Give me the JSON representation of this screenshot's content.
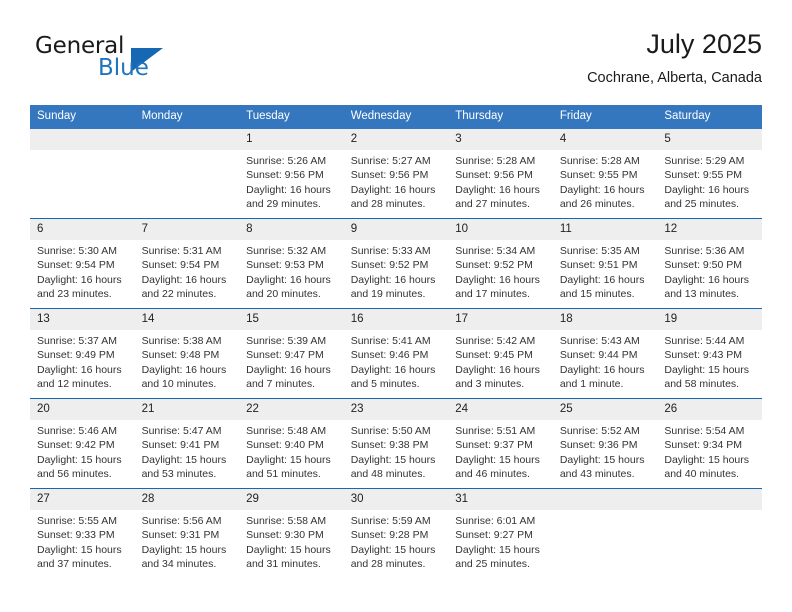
{
  "logo": {
    "word_one": "General",
    "word_two": "Blue",
    "accent_color": "#1668b3",
    "triangle_icon": "triangle-icon"
  },
  "header": {
    "title": "July 2025",
    "location": "Cochrane, Alberta, Canada"
  },
  "theme": {
    "header_bg": "#3577bf",
    "divider": "#1668b3",
    "daynum_bg": "#eeeeee",
    "text": "#222222"
  },
  "calendar": {
    "weekday_headers": [
      "Sunday",
      "Monday",
      "Tuesday",
      "Wednesday",
      "Thursday",
      "Friday",
      "Saturday"
    ],
    "weeks": [
      [
        {
          "day": "",
          "empty": true,
          "sunrise": "",
          "sunset": "",
          "daylight_line1": "",
          "daylight_line2": ""
        },
        {
          "day": "",
          "empty": true,
          "sunrise": "",
          "sunset": "",
          "daylight_line1": "",
          "daylight_line2": ""
        },
        {
          "day": "1",
          "sunrise": "Sunrise: 5:26 AM",
          "sunset": "Sunset: 9:56 PM",
          "daylight_line1": "Daylight: 16 hours",
          "daylight_line2": "and 29 minutes."
        },
        {
          "day": "2",
          "sunrise": "Sunrise: 5:27 AM",
          "sunset": "Sunset: 9:56 PM",
          "daylight_line1": "Daylight: 16 hours",
          "daylight_line2": "and 28 minutes."
        },
        {
          "day": "3",
          "sunrise": "Sunrise: 5:28 AM",
          "sunset": "Sunset: 9:56 PM",
          "daylight_line1": "Daylight: 16 hours",
          "daylight_line2": "and 27 minutes."
        },
        {
          "day": "4",
          "sunrise": "Sunrise: 5:28 AM",
          "sunset": "Sunset: 9:55 PM",
          "daylight_line1": "Daylight: 16 hours",
          "daylight_line2": "and 26 minutes."
        },
        {
          "day": "5",
          "sunrise": "Sunrise: 5:29 AM",
          "sunset": "Sunset: 9:55 PM",
          "daylight_line1": "Daylight: 16 hours",
          "daylight_line2": "and 25 minutes."
        }
      ],
      [
        {
          "day": "6",
          "sunrise": "Sunrise: 5:30 AM",
          "sunset": "Sunset: 9:54 PM",
          "daylight_line1": "Daylight: 16 hours",
          "daylight_line2": "and 23 minutes."
        },
        {
          "day": "7",
          "sunrise": "Sunrise: 5:31 AM",
          "sunset": "Sunset: 9:54 PM",
          "daylight_line1": "Daylight: 16 hours",
          "daylight_line2": "and 22 minutes."
        },
        {
          "day": "8",
          "sunrise": "Sunrise: 5:32 AM",
          "sunset": "Sunset: 9:53 PM",
          "daylight_line1": "Daylight: 16 hours",
          "daylight_line2": "and 20 minutes."
        },
        {
          "day": "9",
          "sunrise": "Sunrise: 5:33 AM",
          "sunset": "Sunset: 9:52 PM",
          "daylight_line1": "Daylight: 16 hours",
          "daylight_line2": "and 19 minutes."
        },
        {
          "day": "10",
          "sunrise": "Sunrise: 5:34 AM",
          "sunset": "Sunset: 9:52 PM",
          "daylight_line1": "Daylight: 16 hours",
          "daylight_line2": "and 17 minutes."
        },
        {
          "day": "11",
          "sunrise": "Sunrise: 5:35 AM",
          "sunset": "Sunset: 9:51 PM",
          "daylight_line1": "Daylight: 16 hours",
          "daylight_line2": "and 15 minutes."
        },
        {
          "day": "12",
          "sunrise": "Sunrise: 5:36 AM",
          "sunset": "Sunset: 9:50 PM",
          "daylight_line1": "Daylight: 16 hours",
          "daylight_line2": "and 13 minutes."
        }
      ],
      [
        {
          "day": "13",
          "sunrise": "Sunrise: 5:37 AM",
          "sunset": "Sunset: 9:49 PM",
          "daylight_line1": "Daylight: 16 hours",
          "daylight_line2": "and 12 minutes."
        },
        {
          "day": "14",
          "sunrise": "Sunrise: 5:38 AM",
          "sunset": "Sunset: 9:48 PM",
          "daylight_line1": "Daylight: 16 hours",
          "daylight_line2": "and 10 minutes."
        },
        {
          "day": "15",
          "sunrise": "Sunrise: 5:39 AM",
          "sunset": "Sunset: 9:47 PM",
          "daylight_line1": "Daylight: 16 hours",
          "daylight_line2": "and 7 minutes."
        },
        {
          "day": "16",
          "sunrise": "Sunrise: 5:41 AM",
          "sunset": "Sunset: 9:46 PM",
          "daylight_line1": "Daylight: 16 hours",
          "daylight_line2": "and 5 minutes."
        },
        {
          "day": "17",
          "sunrise": "Sunrise: 5:42 AM",
          "sunset": "Sunset: 9:45 PM",
          "daylight_line1": "Daylight: 16 hours",
          "daylight_line2": "and 3 minutes."
        },
        {
          "day": "18",
          "sunrise": "Sunrise: 5:43 AM",
          "sunset": "Sunset: 9:44 PM",
          "daylight_line1": "Daylight: 16 hours",
          "daylight_line2": "and 1 minute."
        },
        {
          "day": "19",
          "sunrise": "Sunrise: 5:44 AM",
          "sunset": "Sunset: 9:43 PM",
          "daylight_line1": "Daylight: 15 hours",
          "daylight_line2": "and 58 minutes."
        }
      ],
      [
        {
          "day": "20",
          "sunrise": "Sunrise: 5:46 AM",
          "sunset": "Sunset: 9:42 PM",
          "daylight_line1": "Daylight: 15 hours",
          "daylight_line2": "and 56 minutes."
        },
        {
          "day": "21",
          "sunrise": "Sunrise: 5:47 AM",
          "sunset": "Sunset: 9:41 PM",
          "daylight_line1": "Daylight: 15 hours",
          "daylight_line2": "and 53 minutes."
        },
        {
          "day": "22",
          "sunrise": "Sunrise: 5:48 AM",
          "sunset": "Sunset: 9:40 PM",
          "daylight_line1": "Daylight: 15 hours",
          "daylight_line2": "and 51 minutes."
        },
        {
          "day": "23",
          "sunrise": "Sunrise: 5:50 AM",
          "sunset": "Sunset: 9:38 PM",
          "daylight_line1": "Daylight: 15 hours",
          "daylight_line2": "and 48 minutes."
        },
        {
          "day": "24",
          "sunrise": "Sunrise: 5:51 AM",
          "sunset": "Sunset: 9:37 PM",
          "daylight_line1": "Daylight: 15 hours",
          "daylight_line2": "and 46 minutes."
        },
        {
          "day": "25",
          "sunrise": "Sunrise: 5:52 AM",
          "sunset": "Sunset: 9:36 PM",
          "daylight_line1": "Daylight: 15 hours",
          "daylight_line2": "and 43 minutes."
        },
        {
          "day": "26",
          "sunrise": "Sunrise: 5:54 AM",
          "sunset": "Sunset: 9:34 PM",
          "daylight_line1": "Daylight: 15 hours",
          "daylight_line2": "and 40 minutes."
        }
      ],
      [
        {
          "day": "27",
          "sunrise": "Sunrise: 5:55 AM",
          "sunset": "Sunset: 9:33 PM",
          "daylight_line1": "Daylight: 15 hours",
          "daylight_line2": "and 37 minutes."
        },
        {
          "day": "28",
          "sunrise": "Sunrise: 5:56 AM",
          "sunset": "Sunset: 9:31 PM",
          "daylight_line1": "Daylight: 15 hours",
          "daylight_line2": "and 34 minutes."
        },
        {
          "day": "29",
          "sunrise": "Sunrise: 5:58 AM",
          "sunset": "Sunset: 9:30 PM",
          "daylight_line1": "Daylight: 15 hours",
          "daylight_line2": "and 31 minutes."
        },
        {
          "day": "30",
          "sunrise": "Sunrise: 5:59 AM",
          "sunset": "Sunset: 9:28 PM",
          "daylight_line1": "Daylight: 15 hours",
          "daylight_line2": "and 28 minutes."
        },
        {
          "day": "31",
          "sunrise": "Sunrise: 6:01 AM",
          "sunset": "Sunset: 9:27 PM",
          "daylight_line1": "Daylight: 15 hours",
          "daylight_line2": "and 25 minutes."
        },
        {
          "day": "",
          "empty": true,
          "sunrise": "",
          "sunset": "",
          "daylight_line1": "",
          "daylight_line2": ""
        },
        {
          "day": "",
          "empty": true,
          "sunrise": "",
          "sunset": "",
          "daylight_line1": "",
          "daylight_line2": ""
        }
      ]
    ]
  }
}
